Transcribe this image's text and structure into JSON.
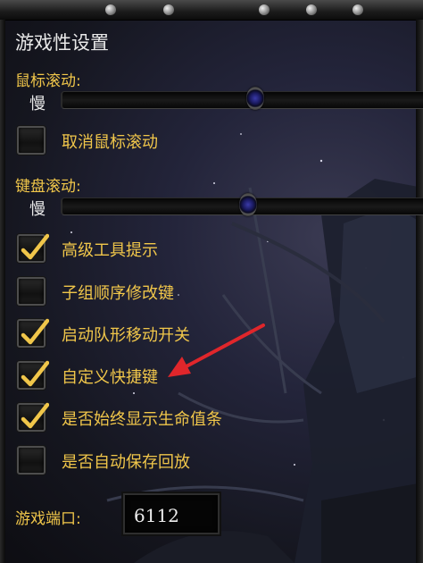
{
  "title": "游戏性设置",
  "mouse_scroll": {
    "label": "鼠标滚动:",
    "slow_label": "慢",
    "level_percent": 53
  },
  "disable_mouse_scroll": {
    "label": "取消鼠标滚动",
    "checked": false
  },
  "keyboard_scroll": {
    "label": "键盘滚动:",
    "slow_label": "慢",
    "level_percent": 51
  },
  "options": [
    {
      "label": "高级工具提示",
      "checked": true
    },
    {
      "label": "子组顺序修改键",
      "checked": false
    },
    {
      "label": "启动队形移动开关",
      "checked": true
    },
    {
      "label": "自定义快捷键",
      "checked": true
    },
    {
      "label": "是否始终显示生命值条",
      "checked": true
    },
    {
      "label": "是否自动保存回放",
      "checked": false
    }
  ],
  "game_port": {
    "label": "游戏端口:",
    "value": "6112"
  },
  "colors": {
    "gold": "#f0c64a",
    "annotation_arrow": "#e0262b"
  }
}
